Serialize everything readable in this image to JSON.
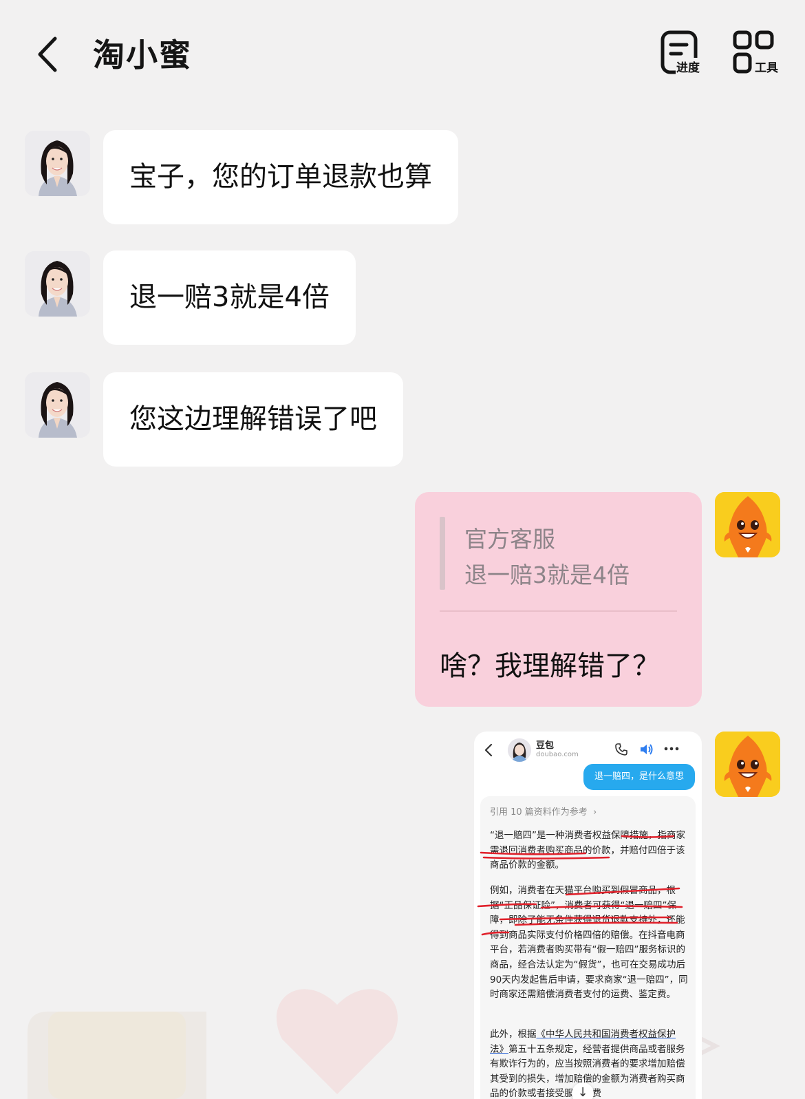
{
  "header": {
    "title": "淘小蜜",
    "progress_label": "进度",
    "tools_label": "工具"
  },
  "messages": [
    {
      "text": "宝子，您的订单退款也算"
    },
    {
      "text": "退一赔3就是4倍"
    },
    {
      "text": "您这边理解错误了吧"
    }
  ],
  "reply": {
    "quote_name": "官方客服",
    "quote_text": "退一赔3就是4倍",
    "text": "啥？我理解错了？"
  },
  "screenshot": {
    "bot_name": "豆包",
    "bot_domain": "doubao.com",
    "question": "退一赔四，是什么意思",
    "refs": "引用 10 篇资料作为参考",
    "refs_arrow": "›",
    "p1": "“退一赔四”是一种消费者权益保障措施，指商家需退回消费者购买商品的价款，并赔付四倍于该商品价款的金额。",
    "p2": "例如，消费者在天猫平台购买到假冒商品，根据“正品保证险”，消费者可获得“退一赔四”保障，即除了能无条件获得退货退款支持外，还能得到商品实际支付价格四倍的赔偿。在抖音电商平台，若消费者购买带有“假一赔四”服务标识的商品，经合法认定为“假货”，也可在交易成功后90天内发起售后申请，要求商家“退一赔四”，同时商家还需赔偿消费者支付的运费、鉴定费。",
    "p3_pre": "此外，根据",
    "p3_law": "《中华人民共和国消费者权益保护法》",
    "p3_post": "第五十五条规定，经营者提供商品或者服务有欺诈行为的，应当按照消费者的要求增加赔偿其受到的损失，增加赔偿的金额为消费者购买商品的价款或者接受服务的费",
    "scroll_down": "↓"
  },
  "colors": {
    "background": "#f2f1f1",
    "bubble_left": "#ffffff",
    "bubble_right": "#f9d0dc",
    "question_bubble": "#27a9ee",
    "annotation_red": "#e0202a"
  }
}
